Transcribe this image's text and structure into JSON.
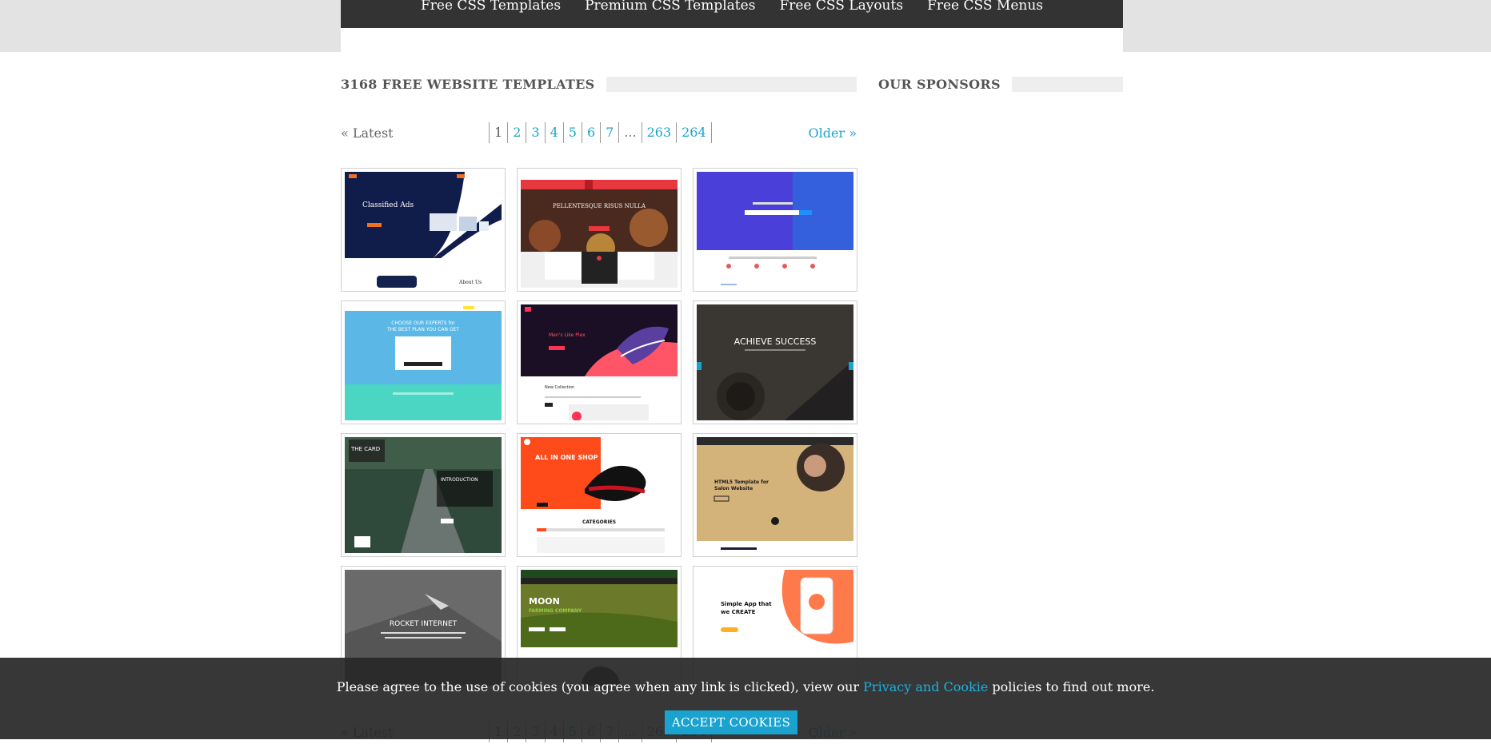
{
  "nav": {
    "items": [
      "Free CSS Templates",
      "Premium CSS Templates",
      "Free CSS Layouts",
      "Free CSS Menus"
    ]
  },
  "main": {
    "heading": "3168 FREE WEBSITE TEMPLATES",
    "pager": {
      "latest": "« Latest",
      "older": "Older »",
      "pages": [
        "1",
        "2",
        "3",
        "4",
        "5",
        "6",
        "7",
        "...",
        "263",
        "264"
      ],
      "current": "1"
    }
  },
  "sidebar": {
    "heading": "OUR SPONSORS"
  },
  "templates": [
    {
      "text": "Classified Ads",
      "text2": "About Us"
    },
    {
      "text": "PELLENTESQUE RISUS NULLA",
      "text2": ""
    },
    {
      "text": "",
      "text2": ""
    },
    {
      "text": "CHOOSE OUR EXPERTS for",
      "text2": "THE BEST PLAN YOU CAN GET"
    },
    {
      "text": "Men's Like Plex",
      "text2": "New Collection"
    },
    {
      "text": "ACHIEVE SUCCESS",
      "text2": ""
    },
    {
      "text": "THE CARD",
      "text2": "INTRODUCTION"
    },
    {
      "text": "ALL IN ONE SHOP",
      "text2": "CATEGORIES"
    },
    {
      "text": "HTML5 Template for",
      "text2": "Salon Website"
    },
    {
      "text": "ROCKET INTERNET",
      "text2": ""
    },
    {
      "text": "MOON",
      "text2": "FARMING COMPANY"
    },
    {
      "text": "Simple App that",
      "text2": "we CREATE"
    }
  ],
  "cookie": {
    "text_before": "Please agree to the use of cookies (you agree when any link is clicked), view our",
    "link": "Privacy and Cookie",
    "text_after": "policies to find out more.",
    "button": "ACCEPT COOKIES"
  },
  "colors": {
    "accent": "#1aa3cf",
    "nav_bg": "#333333",
    "cookie_bg": "#282828"
  }
}
